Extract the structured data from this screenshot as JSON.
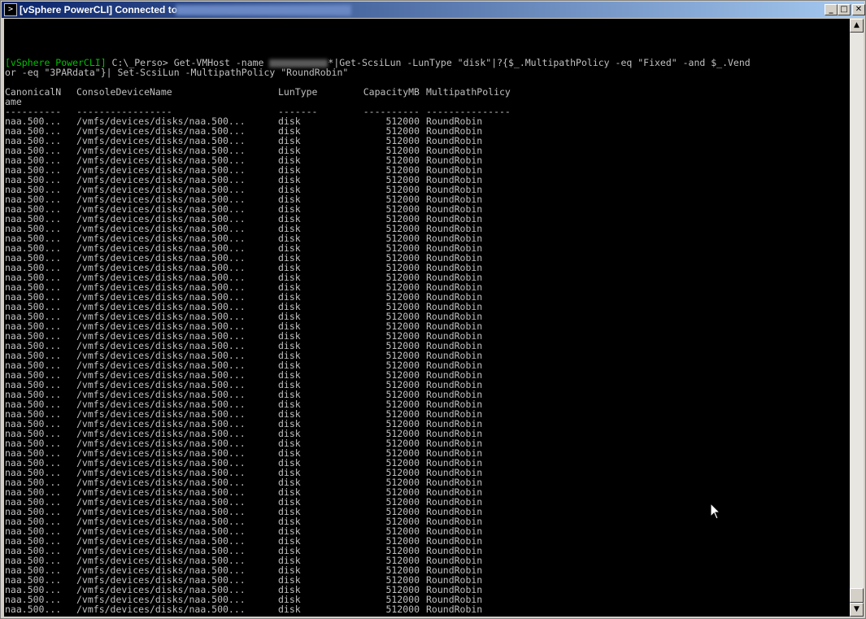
{
  "window": {
    "title": "[vSphere PowerCLI] Connected to",
    "icon": "powershell-console-icon",
    "controls": {
      "minimize": "_",
      "maximize": "□",
      "close": "✕"
    }
  },
  "console": {
    "command": {
      "prompt_tag": "[vSphere PowerCLI]",
      "line1_a": " C:\\_Perso> Get-VMHost -name ",
      "line1_b": "*|Get-ScsiLun -LunType \"disk\"|?{$_.MultipathPolicy -eq \"Fixed\" -and $_.Vend",
      "line2": "or -eq \"3PARdata\"}| Set-ScsiLun -MultipathPolicy \"RoundRobin\""
    },
    "table": {
      "headers": {
        "canonical": "CanonicalN",
        "canonical_wrap": "ame",
        "console_device": "ConsoleDeviceName",
        "lun_type": "LunType",
        "capacity": "CapacityMB",
        "multipath": "MultipathPolicy"
      },
      "separators": {
        "canonical": "----------",
        "console_device": "-----------------",
        "lun_type": "-------",
        "capacity": "----------",
        "multipath": "---------------"
      },
      "row_template": {
        "canonical": "naa.500...",
        "console_device": "/vmfs/devices/disks/naa.500...",
        "lun_type": "disk",
        "capacity": "512000",
        "multipath": "RoundRobin"
      },
      "row_count": 51
    }
  },
  "scrollbar": {
    "up_arrow": "▲",
    "down_arrow": "▼"
  }
}
